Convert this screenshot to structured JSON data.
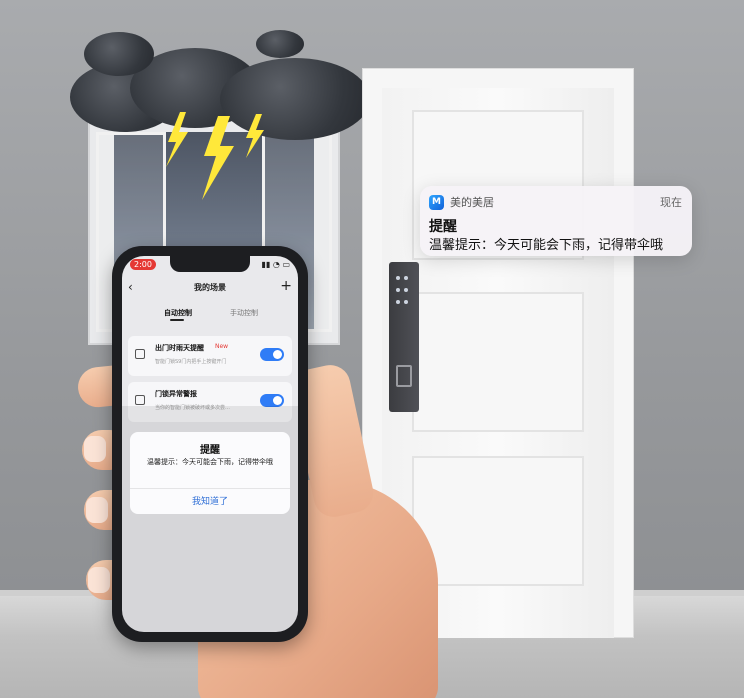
{
  "notification": {
    "app_name": "美的美居",
    "time": "现在",
    "title": "提醒",
    "body": "温馨提示：今天可能会下雨，记得带伞哦"
  },
  "phone": {
    "status_time": "2:00",
    "nav": {
      "back": "‹",
      "title": "我的场景",
      "add": "+"
    },
    "tabs": [
      {
        "label": "自动控制",
        "active": true
      },
      {
        "label": "手动控制",
        "active": false
      }
    ],
    "scenes": [
      {
        "name": "出门时雨天提醒",
        "tag": "New",
        "desc": "智能门锁S9门内把手上按键开门",
        "enabled": true
      },
      {
        "name": "门锁异常警报",
        "tag": "",
        "desc": "当你的智能门锁被破坏或多次尝…",
        "enabled": true
      }
    ],
    "dialog": {
      "title": "提醒",
      "body": "温馨提示：今天可能会下雨，记得带伞哦",
      "button": "我知道了"
    }
  },
  "colors": {
    "toggle_on": "#2f7cf6",
    "status_badge": "#e53935",
    "dialog_button": "#2f6fd6",
    "tag_new": "#e53935"
  },
  "icons": [
    "app-logo-icon",
    "chevron-left-icon",
    "plus-icon",
    "wifi-icon",
    "battery-icon",
    "device-icon"
  ]
}
